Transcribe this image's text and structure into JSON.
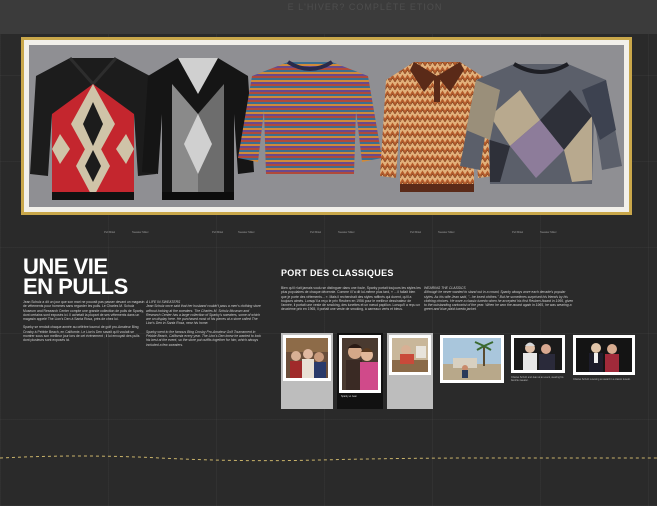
{
  "background": {
    "top_strip_text": "E L'HIVER?  COMPLÈTE  ETION"
  },
  "panel": {
    "sweaters": [
      {
        "name": "red-black-argyle-sweater",
        "colors": [
          "#1c1c1c",
          "#c4262e",
          "#cfc3a8"
        ]
      },
      {
        "name": "black-grey-vest-sweater",
        "colors": [
          "#151515",
          "#8a8a8a",
          "#d0d0d0"
        ]
      },
      {
        "name": "multicolor-stripe-sweater",
        "colors": [
          "#6a4a8c",
          "#b04a3a",
          "#3d6e8f"
        ]
      },
      {
        "name": "orange-zigzag-polo-sweater",
        "colors": [
          "#b55a2a",
          "#e2b07a",
          "#5a2a18"
        ]
      },
      {
        "name": "patchwork-grey-sweater",
        "colors": [
          "#5b5f6a",
          "#b8a98e",
          "#2e3039"
        ]
      }
    ]
  },
  "captions": [
    "Pull Mikel",
    "Sweater Mikel",
    "Pull Mikel",
    "Sweater Mikel",
    "Pull Mikel",
    "Sweater Mikel",
    "Pull Mikel",
    "Sweater Mikel",
    "Pull Mikel",
    "Sweater Mikel"
  ],
  "section1": {
    "title_line1": "UNE VIE",
    "title_line2": "EN PULLS",
    "col1_p1": "Jean Schulz a dit un jour que son mari ne pouvait pas passer devant un magasin de vêtements pour hommes sans regarder les pulls. Le Charles M. Schulz Museum and Research Center compte une grande collection de pulls de Sparky, dont certains sont exposés ici. Il achetait la plupart de ses vêtements dans un magasin appelé The Lion's Den à Santa Rosa, près de chez lui.",
    "col1_p2": "Sparky se rendait chaque année au célèbre tournoi de golf pro-Amateur Bing Crosby à Pebble Beach, en Californie. Le Lion's Den savait qu'il voulait se montrer sous son meilleur jour lors de cet événement ; il lui envoyait des pulls dont plusieurs sont exposés ici.",
    "col2_heading": "A LIFE IN SWEATERS",
    "col2_p1": "Jean Schulz once said that her husband couldn't pass a men's clothing store without looking at the sweaters. The Charles M. Schulz Museum and Research Center has a large collection of Sparky's sweaters, some of which are on display here. He purchased most of his pieces at a store called The Lion's Den in Santa Rosa, near his home.",
    "col2_p2": "Sparky went to the famous Bing Crosby Pro-Amateur Golf Tournament in Pebble Beach, California every year. The Lion's Den knew he wanted to look his best at the event, so the store put outfits together for him, which always included a few sweaters."
  },
  "section2": {
    "heading": "PORT DES CLASSIQUES",
    "col1_p1": "Bien qu'il n'ait jamais voulu se distinguer dans une foule, Sparky portait toujours les styles les plus populaires de chaque décennie. Comme il l'a dit lui-même plus tard, « ... il fallait bien que je porte des vêtements... ». Mais il recherchait des styles raffinés qui durent, qu'il a toujours aimés. Lorsqu'il a reçu le prix Reuben en 1956 pour le meilleur dessinateur de l'année, il portait une veste de smoking, des lunettes et un nœud papillon. Lorsqu'il a reçu un deuxième prix en 1965, il portait une veste de smoking, à carreaux verts et bleus.",
    "col2_heading": "WEARING THE CLASSICS",
    "col2_p1": "Although he never wanted to stand out in a crowd, Sparky always wore each decade's popular styles. As his wife Jean said, \"...he loved clothes.\" But he sometimes surprised his friends by his clothing choices. He wore a classic tuxedo when he accepted his first Reuben Award in 1956, given to the outstanding cartoonist of the year. When he won the award again in 1965, he was wearing a green and blue plaid tuxedo jacket."
  },
  "photos": [
    {
      "name": "photo-family-group",
      "caption": ""
    },
    {
      "name": "photo-couple-pink",
      "caption": "Sparky et Jean"
    },
    {
      "name": "photo-man-desk",
      "caption": ""
    },
    {
      "name": "photo-palm-trees-outdoor",
      "caption": ""
    },
    {
      "name": "photo-man-woman-event",
      "caption": "Charles Schulz and Jean at an event, wearing his favorite sweater."
    },
    {
      "name": "photo-man-award",
      "caption": "Charles Schulz receiving an award in a classic tuxedo."
    }
  ],
  "colors": {
    "gold_frame": "#c9a74a",
    "background": "#262626",
    "title": "#ffffff",
    "dash_line": "#c9b36a"
  }
}
